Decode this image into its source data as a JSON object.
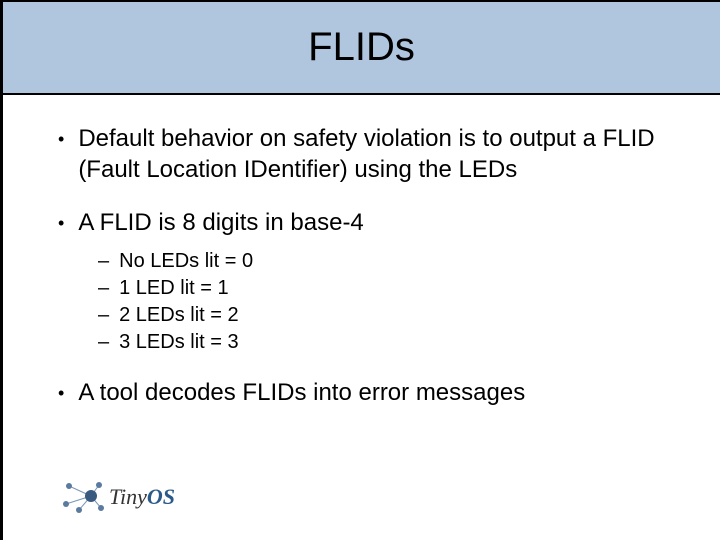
{
  "title": "FLIDs",
  "bullets": [
    "Default behavior on safety violation is to output a FLID (Fault Location IDentifier) using the LEDs",
    "A FLID is 8 digits in base-4",
    "A tool decodes FLIDs into error messages"
  ],
  "sub_bullets": [
    "No LEDs lit = 0",
    "1 LED lit = 1",
    "2 LEDs lit = 2",
    "3 LEDs lit = 3"
  ],
  "logo": {
    "tiny": "Tiny",
    "os": "OS"
  }
}
